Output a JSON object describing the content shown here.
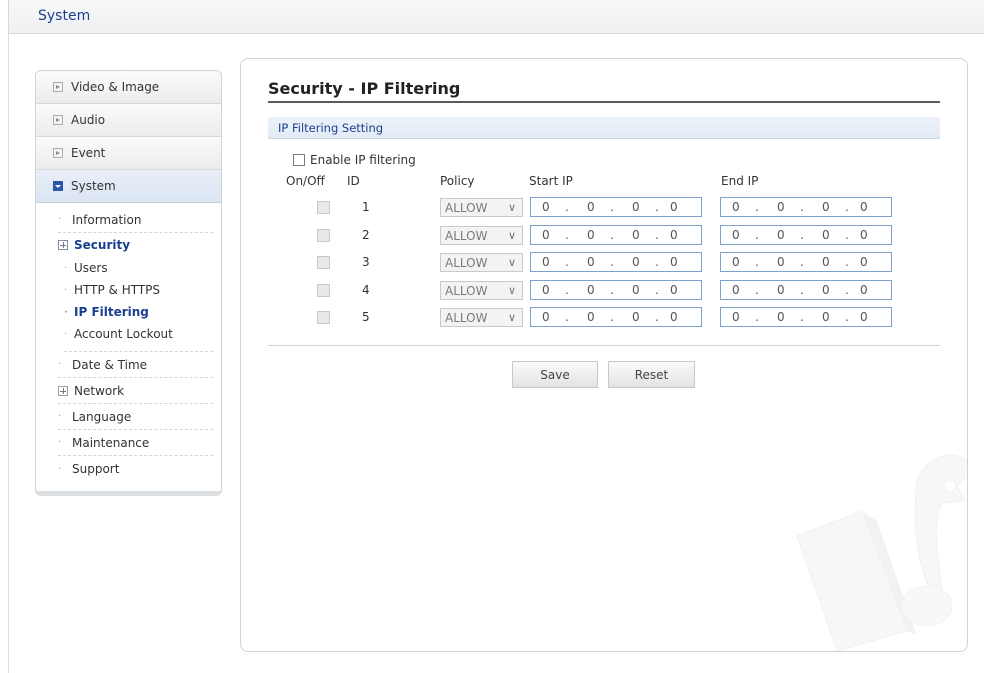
{
  "header": {
    "title": "System"
  },
  "sidebar": {
    "top_items": [
      {
        "label": "Video & Image"
      },
      {
        "label": "Audio"
      },
      {
        "label": "Event"
      },
      {
        "label": "System"
      }
    ],
    "system_items": {
      "information": "Information",
      "security": "Security",
      "security_children": [
        "Users",
        "HTTP & HTTPS",
        "IP Filtering",
        "Account Lockout"
      ],
      "date_time": "Date & Time",
      "network": "Network",
      "language": "Language",
      "maintenance": "Maintenance",
      "support": "Support"
    }
  },
  "main": {
    "title": "Security - IP Filtering",
    "section": "IP Filtering Setting",
    "enable_label": "Enable IP filtering",
    "columns": {
      "onoff": "On/Off",
      "id": "ID",
      "policy": "Policy",
      "start_ip": "Start IP",
      "end_ip": "End IP"
    },
    "rows": [
      {
        "id": "1",
        "policy": "ALLOW",
        "start": [
          "0",
          "0",
          "0",
          "0"
        ],
        "end": [
          "0",
          "0",
          "0",
          "0"
        ]
      },
      {
        "id": "2",
        "policy": "ALLOW",
        "start": [
          "0",
          "0",
          "0",
          "0"
        ],
        "end": [
          "0",
          "0",
          "0",
          "0"
        ]
      },
      {
        "id": "3",
        "policy": "ALLOW",
        "start": [
          "0",
          "0",
          "0",
          "0"
        ],
        "end": [
          "0",
          "0",
          "0",
          "0"
        ]
      },
      {
        "id": "4",
        "policy": "ALLOW",
        "start": [
          "0",
          "0",
          "0",
          "0"
        ],
        "end": [
          "0",
          "0",
          "0",
          "0"
        ]
      },
      {
        "id": "5",
        "policy": "ALLOW",
        "start": [
          "0",
          "0",
          "0",
          "0"
        ],
        "end": [
          "0",
          "0",
          "0",
          "0"
        ]
      }
    ],
    "save_label": "Save",
    "reset_label": "Reset"
  },
  "colors": {
    "accent": "#1a3f8f",
    "section_bg": "#e6edf7",
    "ip_border": "#7da2ce"
  }
}
